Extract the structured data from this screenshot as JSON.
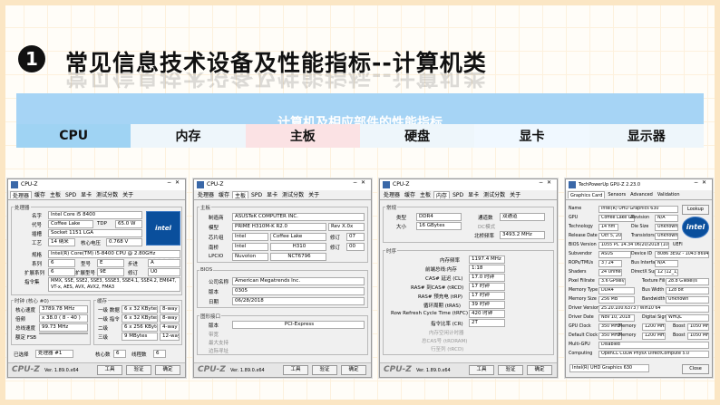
{
  "header": {
    "number": "1",
    "title": "常见信息技术设备及性能指标--计算机类",
    "banner_title": "计算机及相应部件的性能指标"
  },
  "tabs": [
    "CPU",
    "内存",
    "主板",
    "硬盘",
    "显卡",
    "显示器"
  ],
  "cpuz_cpu": {
    "title": "CPU-Z",
    "tabs": [
      "处理器",
      "缓存",
      "主板",
      "SPD",
      "显卡",
      "测试分数",
      "关于"
    ],
    "group_processor": "处理器",
    "name_label": "名字",
    "name_value": "Intel Core i5 8400",
    "code_label": "代号",
    "code_value": "Coffee Lake",
    "tdp_label": "TDP",
    "tdp_value": "65.0 W",
    "socket_label": "插槽",
    "socket_value": "Socket 1151 LGA",
    "process_label": "工艺",
    "process_value": "14 纳米",
    "voltage_label": "核心电压",
    "voltage_value": "0.768 V",
    "spec_label": "规格",
    "spec_value": "Intel(R) Core(TM) i5-8400 CPU @ 2.80GHz",
    "family_label": "系列",
    "family_value": "6",
    "model_label": "型号",
    "model_value": "E",
    "stepping_label": "步进",
    "stepping_value": "A",
    "extfamily_label": "扩展系列",
    "extfamily_value": "6",
    "extmodel_label": "扩展型号",
    "extmodel_value": "9E",
    "revision_label": "修订",
    "revision_value": "U0",
    "instr_label": "指令集",
    "instr_value": "MMX, SSE, SSE2, SSE3, SSSE3, SSE4.1, SSE4.2, EM64T, VT-x, AES, AVX, AVX2, FMA3",
    "group_clock": "时钟 (核心 #0)",
    "core_speed_label": "核心速度",
    "core_speed_value": "3789.78 MHz",
    "mult_label": "倍频",
    "mult_value": "x 38.0 ( 8 - 40 )",
    "bus_label": "总线速度",
    "bus_value": "99.73 MHz",
    "fsb_label": "额定 FSB",
    "group_cache": "缓存",
    "l1d_label": "一级 数据",
    "l1d_value": "6 x 32 KBytes",
    "l1d_way": "8-way",
    "l1i_label": "一级 指令",
    "l1i_value": "6 x 32 KBytes",
    "l1i_way": "8-way",
    "l2_label": "二级",
    "l2_value": "6 x 256 KBytes",
    "l2_way": "4-way",
    "l3_label": "三级",
    "l3_value": "9 MBytes",
    "l3_way": "12-way",
    "selected_label": "已选择",
    "selected_value": "处理器 #1",
    "cores_label": "核心数",
    "cores_value": "6",
    "threads_label": "线程数",
    "threads_value": "6",
    "version": "Ver. 1.89.0.x64",
    "tools": "工具",
    "verify": "验证",
    "ok": "确定",
    "intel_badge": "intel CORE i5"
  },
  "cpuz_mb": {
    "title": "CPU-Z",
    "tabs": [
      "处理器",
      "缓存",
      "主板",
      "SPD",
      "显卡",
      "测试分数",
      "关于"
    ],
    "group_mb": "主板",
    "maker_label": "制造商",
    "maker_value": "ASUSTeK COMPUTER INC.",
    "model_label": "模型",
    "model_value": "PRIME H310M-K R2.0",
    "rev_value": "Rev X.0x",
    "chipset_label": "芯片组",
    "chipset_vendor": "Intel",
    "chipset_value": "Coffee Lake",
    "chipset_rev_label": "修订",
    "chipset_rev": "07",
    "south_label": "南桥",
    "south_vendor": "Intel",
    "south_value": "H310",
    "south_rev_label": "修订",
    "south_rev": "00",
    "lpcio_label": "LPCIO",
    "lpcio_vendor": "Nuvoton",
    "lpcio_value": "NCT6796",
    "group_bios": "BIOS",
    "brand_label": "公司名称",
    "brand_value": "American Megatrends Inc.",
    "bver_label": "版本",
    "bver_value": "0305",
    "bdate_label": "日期",
    "bdate_value": "06/28/2018",
    "group_gfx": "图形接口",
    "gver_label": "版本",
    "gver_value": "PCI-Express",
    "gwidth_label": "带宽",
    "gmax_label": "最大支持",
    "gside_label": "边际寻址",
    "version": "Ver. 1.89.0.x64",
    "tools": "工具",
    "verify": "验证",
    "ok": "确定"
  },
  "cpuz_mem": {
    "title": "CPU-Z",
    "tabs": [
      "处理器",
      "缓存",
      "主板",
      "内存",
      "SPD",
      "显卡",
      "测试分数",
      "关于"
    ],
    "group_general": "常规",
    "type_label": "类型",
    "type_value": "DDR4",
    "channel_label": "通道数",
    "channel_value": "双通道",
    "size_label": "大小",
    "size_value": "16 GBytes",
    "dc_label": "DC模式",
    "nb_label": "北桥频率",
    "nb_value": "3493.2 MHz",
    "group_timing": "时序",
    "dram_freq_label": "内存频率",
    "dram_freq_value": "1197.4 MHz",
    "fsb_dram_label": "前端总线:内存",
    "fsb_dram_value": "1:18",
    "cl_label": "CAS# 延迟 (CL)",
    "cl_value": "17.0 时钟",
    "rcd_label": "RAS# 到CAS# (tRCD)",
    "rcd_value": "17 时钟",
    "rp_label": "RAS# 预充电 (tRP)",
    "rp_value": "17 时钟",
    "ras_label": "循环周期 (tRAS)",
    "ras_value": "39 时钟",
    "rfc_label": "Row Refresh Cycle Time (tRFC)",
    "rfc_value": "420 时钟",
    "cr_label": "指令比率 (CR)",
    "cr_value": "2T",
    "idle_label": "内存空闲计时器",
    "cas_label": "总CAS号 (tRDRAM)",
    "rtc_label": "行至列 (tRCD)",
    "version": "Ver. 1.89.0.x64",
    "tools": "工具",
    "verify": "验证",
    "ok": "确定"
  },
  "gpuz": {
    "title": "TechPowerUp GPU-Z 2.23.0",
    "tabs": [
      "Graphics Card",
      "Sensors",
      "Advanced",
      "Validation"
    ],
    "name_label": "Name",
    "name_value": "Intel(R) UHD Graphics 630",
    "lookup": "Lookup",
    "gpu_label": "GPU",
    "gpu_value": "Coffee Lake GT2",
    "revision_label": "Revision",
    "revision_value": "N/A",
    "tech_label": "Technology",
    "tech_value": "14 nm",
    "die_label": "Die Size",
    "die_value": "Unknown",
    "release_label": "Release Date",
    "release_value": "Oct 5, 2017",
    "trans_label": "Transistors",
    "trans_value": "Unknown",
    "bios_label": "BIOS Version",
    "bios_value": "1055 PC 14.34 06/20/2018 (10:31)",
    "uefi": "UEFI",
    "subvendor_label": "Subvendor",
    "subvendor_value": "ASUS",
    "devid_label": "Device ID",
    "devid_value": "8086 3E92 - 1043 8694",
    "rops_label": "ROPs/TMUs",
    "rops_value": "3 / 24",
    "busif_label": "Bus Interface",
    "busif_value": "N/A",
    "shaders_label": "Shaders",
    "shaders_value": "24 Unified",
    "dx_label": "DirectX Support",
    "dx_value": "12 (12_1)",
    "pixel_label": "Pixel Fillrate",
    "pixel_value": "3.6 GPixel/s",
    "texture_label": "Texture Fillrate",
    "texture_value": "28.8 GTexel/s",
    "memtype_label": "Memory Type",
    "memtype_value": "DDR4",
    "buswidth_label": "Bus Width",
    "buswidth_value": "128 bit",
    "memsize_label": "Memory Size",
    "memsize_value": "256 MB",
    "bandwidth_label": "Bandwidth",
    "bandwidth_value": "Unknown",
    "driver_label": "Driver Version",
    "driver_value": "25.20.100.6373 / Win10 64",
    "driverdate_label": "Driver Date",
    "driverdate_value": "Nov 10, 2018",
    "digsig_label": "Digital Signature",
    "digsig_value": "WHQL",
    "gpuclock_label": "GPU Clock",
    "gpuclock_value": "350 MHz",
    "memory_label": "Memory",
    "memory_value": "1200 MHz",
    "boost_label": "Boost",
    "boost_value": "1050 MHz",
    "defclock_label": "Default Clock",
    "defclock_value": "350 MHz",
    "defmemory_value": "1200 MHz",
    "defboost_value": "1050 MHz",
    "multigpu_label": "Multi-GPU",
    "multigpu_value": "Disabled",
    "computing_label": "Computing",
    "computing_items": "OpenCL  CUDA  PhysX  DirectCompute 5.0",
    "select_value": "Intel(R) UHD Graphics 630",
    "close": "Close",
    "intel_badge": "intel"
  }
}
